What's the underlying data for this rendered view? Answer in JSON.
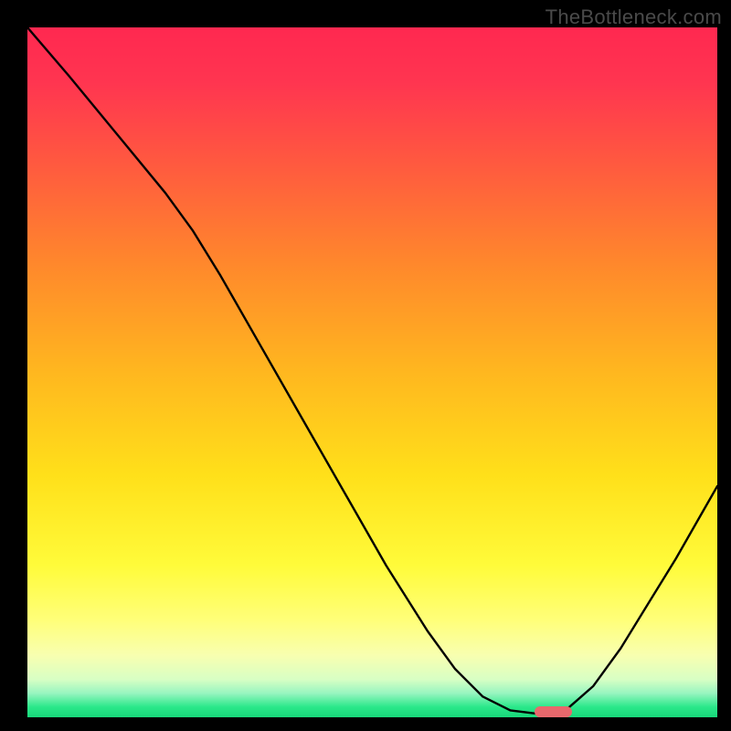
{
  "watermark": "TheBottleneck.com",
  "chart_data": {
    "type": "line",
    "title": "",
    "xlabel": "",
    "ylabel": "",
    "x_range": [
      0,
      100
    ],
    "y_range": [
      0,
      100
    ],
    "gradient_stops": [
      {
        "pos": 0.0,
        "color": "#ff2850"
      },
      {
        "pos": 0.08,
        "color": "#ff3550"
      },
      {
        "pos": 0.2,
        "color": "#ff5a3f"
      },
      {
        "pos": 0.35,
        "color": "#ff8a2b"
      },
      {
        "pos": 0.5,
        "color": "#ffb71f"
      },
      {
        "pos": 0.65,
        "color": "#ffe01a"
      },
      {
        "pos": 0.78,
        "color": "#fffb3a"
      },
      {
        "pos": 0.86,
        "color": "#ffff7a"
      },
      {
        "pos": 0.91,
        "color": "#f8ffb0"
      },
      {
        "pos": 0.945,
        "color": "#d8ffc4"
      },
      {
        "pos": 0.965,
        "color": "#98f5c0"
      },
      {
        "pos": 0.985,
        "color": "#2ae88a"
      },
      {
        "pos": 1.0,
        "color": "#18d87a"
      }
    ],
    "curve_points": [
      {
        "x": 0.0,
        "y": 100.0
      },
      {
        "x": 6.0,
        "y": 93.0
      },
      {
        "x": 13.0,
        "y": 84.5
      },
      {
        "x": 20.0,
        "y": 76.0
      },
      {
        "x": 24.0,
        "y": 70.5
      },
      {
        "x": 28.0,
        "y": 64.0
      },
      {
        "x": 34.0,
        "y": 53.5
      },
      {
        "x": 40.0,
        "y": 43.0
      },
      {
        "x": 46.0,
        "y": 32.5
      },
      {
        "x": 52.0,
        "y": 22.0
      },
      {
        "x": 58.0,
        "y": 12.5
      },
      {
        "x": 62.0,
        "y": 7.0
      },
      {
        "x": 66.0,
        "y": 3.0
      },
      {
        "x": 70.0,
        "y": 1.0
      },
      {
        "x": 74.0,
        "y": 0.5
      },
      {
        "x": 78.0,
        "y": 1.0
      },
      {
        "x": 82.0,
        "y": 4.5
      },
      {
        "x": 86.0,
        "y": 10.0
      },
      {
        "x": 90.0,
        "y": 16.5
      },
      {
        "x": 94.0,
        "y": 23.0
      },
      {
        "x": 98.0,
        "y": 30.0
      },
      {
        "x": 100.0,
        "y": 33.5
      }
    ],
    "optimal_marker": {
      "x": 73.5,
      "width": 5.5,
      "height": 1.6
    }
  }
}
